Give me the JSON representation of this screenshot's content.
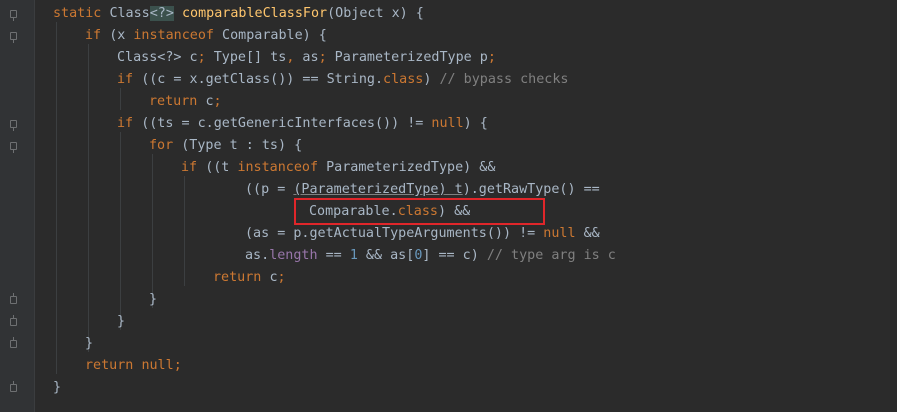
{
  "code": {
    "l1": {
      "static": "static ",
      "cls": "Class",
      "gen": "<?>",
      "sp": " ",
      "method": "comparableClassFor",
      "rest": "(Object x) {"
    },
    "l2": {
      "if": "if ",
      "a": "(x ",
      "instanceof": "instanceof",
      "b": " Comparable) {"
    },
    "l3": {
      "a": "Class<?> c",
      "s1": ";",
      "b": " Type[] ts",
      "c1": ",",
      "c": " as",
      "s2": ";",
      "d": " ParameterizedType p",
      "s3": ";"
    },
    "l4": {
      "if": "if ",
      "a": "((c = x.getClass()) == String.",
      "class": "class",
      "b": ") ",
      "comment": "// bypass checks"
    },
    "l5": {
      "return": "return ",
      "a": "c",
      "s": ";"
    },
    "l6": {
      "if": "if ",
      "a": "((ts = c.getGenericInterfaces()) != ",
      "null": "null",
      "b": ") {"
    },
    "l7": {
      "for": "for ",
      "a": "(Type t : ts) {"
    },
    "l8": {
      "if": "if ",
      "a": "((t ",
      "instanceof": "instanceof",
      "b": " ParameterizedType) &&"
    },
    "l9": {
      "a": "((p = ",
      "b": "(ParameterizedType) t",
      "c": ").getRawType() =="
    },
    "l10": {
      "a": "Comparable.",
      "class": "class",
      "b": ") &&"
    },
    "l11": {
      "a": "(as = p.getActualTypeArguments()) != ",
      "null": "null",
      "b": " &&"
    },
    "l12": {
      "a": "as.",
      "length": "length",
      "b": " == ",
      "one": "1",
      "c": " && as[",
      "zero": "0",
      "d": "] == c) ",
      "comment": "// type arg is c"
    },
    "l13": {
      "return": "return ",
      "a": "c",
      "s": ";"
    },
    "l14": {
      "a": "}"
    },
    "l15": {
      "a": "}"
    },
    "l16": {
      "a": "}"
    },
    "l17": {
      "return": "return ",
      "null": "null",
      "s": ";"
    },
    "l18": {
      "a": "}"
    }
  },
  "colors": {
    "background": "#2b2b2b",
    "keyword": "#cc7832",
    "method": "#ffc66d",
    "comment": "#808080",
    "number": "#6897bb",
    "field": "#9876aa",
    "text": "#a9b7c6",
    "highlight_box": "#e0262a"
  }
}
